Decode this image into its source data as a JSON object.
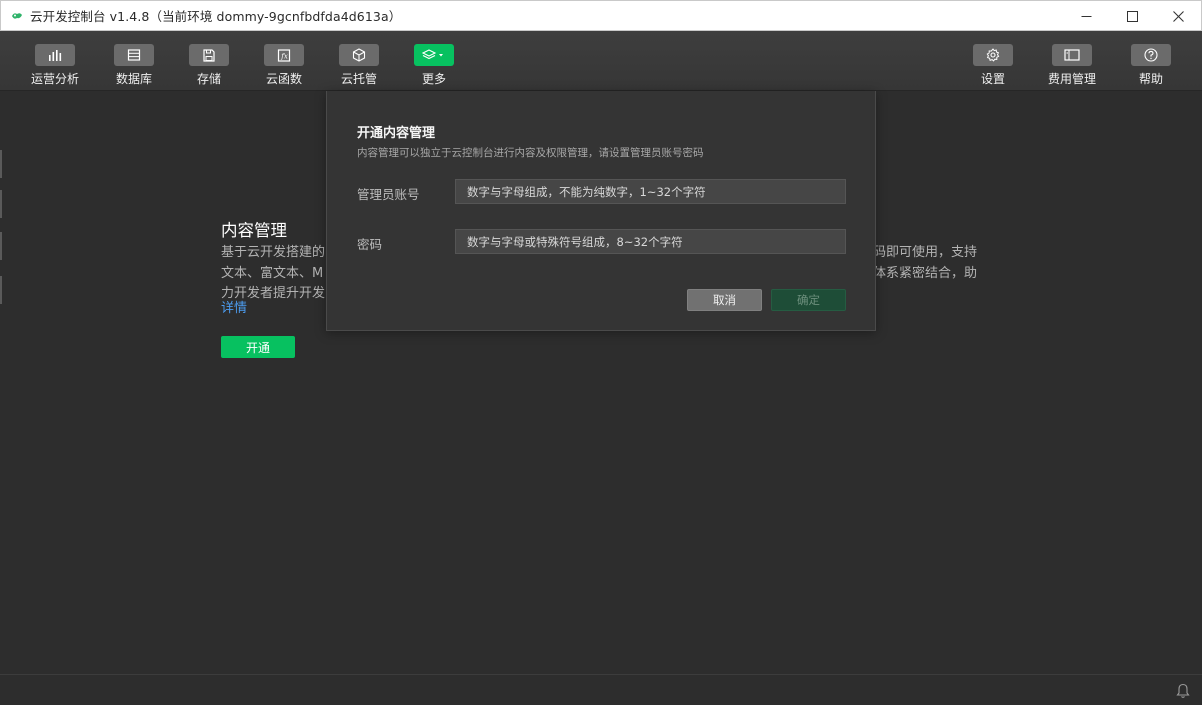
{
  "window": {
    "title": "云开发控制台 v1.4.8（当前环境 dommy-9gcnfbdfda4d613a）",
    "controls": [
      "minimize",
      "maximize",
      "close"
    ]
  },
  "toolbar": {
    "left": [
      {
        "label": "运营分析",
        "icon": "bar-chart-icon"
      },
      {
        "label": "数据库",
        "icon": "database-icon"
      },
      {
        "label": "存储",
        "icon": "storage-icon"
      },
      {
        "label": "云函数",
        "icon": "function-icon"
      },
      {
        "label": "云托管",
        "icon": "cube-icon"
      },
      {
        "label": "更多",
        "icon": "layers-icon",
        "active": true
      }
    ],
    "right": [
      {
        "label": "设置",
        "icon": "gear-icon"
      },
      {
        "label": "费用管理",
        "icon": "billing-icon"
      },
      {
        "label": "帮助",
        "icon": "help-icon"
      }
    ]
  },
  "intro": {
    "title": "内容管理",
    "description_line1": "基于云开发搭建的",
    "description_line1_end": "码即可使用，支持",
    "description_line2": "文本、富文本、M",
    "description_line2_end": "体系紧密结合，助",
    "description_line3": "力开发者提升开发",
    "details_link": "详情",
    "open_button": "开通"
  },
  "modal": {
    "title": "开通内容管理",
    "subtitle": "内容管理可以独立于云控制台进行内容及权限管理，请设置管理员账号密码",
    "account_label": "管理员账号",
    "account_placeholder": "数字与字母组成，不能为纯数字，1~32个字符",
    "password_label": "密码",
    "password_placeholder": "数字与字母或特殊符号组成，8~32个字符",
    "cancel_label": "取消",
    "confirm_label": "确定"
  },
  "colors": {
    "accent": "#07c160",
    "link": "#4c9cf0",
    "background": "#2d2d2d"
  }
}
